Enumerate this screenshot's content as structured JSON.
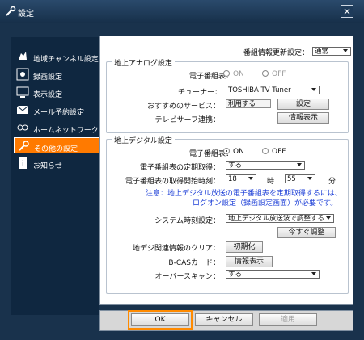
{
  "window": {
    "title": "設定"
  },
  "sidebar": {
    "items": [
      {
        "label": "地域チャンネル設定",
        "icon": "map-icon"
      },
      {
        "label": "録画設定",
        "icon": "record-icon"
      },
      {
        "label": "表示設定",
        "icon": "display-icon"
      },
      {
        "label": "メール予約設定",
        "icon": "mail-icon"
      },
      {
        "label": "ホームネットワーク設定",
        "icon": "network-icon"
      },
      {
        "label": "その他の設定",
        "icon": "wrench-icon",
        "active": true
      },
      {
        "label": "お知らせ",
        "icon": "info-icon"
      }
    ]
  },
  "main": {
    "guide_update": {
      "label": "番組情報更新設定：",
      "value": "通常"
    },
    "analog": {
      "title": "地上アナログ設定",
      "epg_label": "電子番組表：",
      "on_label": "ON",
      "off_label": "OFF",
      "tuner_label": "チューナー：",
      "tuner_value": "TOSHIBA TV Tuner",
      "recommend_label": "おすすめのサービス：",
      "recommend_value": "利用する",
      "recommend_button": "設定",
      "telesurf_label": "テレビサーフ連携：",
      "telesurf_button": "情報表示"
    },
    "digital": {
      "title": "地上デジタル設定",
      "epg_label": "電子番組表：",
      "on_label": "ON",
      "off_label": "OFF",
      "periodic_label": "電子番組表の定期取得：",
      "periodic_value": "する",
      "start_time_label": "電子番組表の取得開始時刻：",
      "hour_value": "18",
      "hour_unit": "時",
      "minute_value": "55",
      "minute_unit": "分",
      "note_line1": "注意：地上デジタル放送の電子番組表を定期取得するには、",
      "note_line2": "ログオン設定（録画設定画面）が必要です。",
      "clock_label": "システム時刻設定：",
      "clock_value": "地上デジタル放送波で調整する",
      "adjust_now_button": "今すぐ調整",
      "clear_label": "地デジ関連情報のクリア：",
      "clear_button": "初期化",
      "bcas_label": "B-CASカード：",
      "bcas_button": "情報表示",
      "overscan_label": "オーバースキャン：",
      "overscan_value": "する"
    }
  },
  "footer": {
    "ok": "OK",
    "cancel": "キャンセル",
    "apply": "適用"
  }
}
